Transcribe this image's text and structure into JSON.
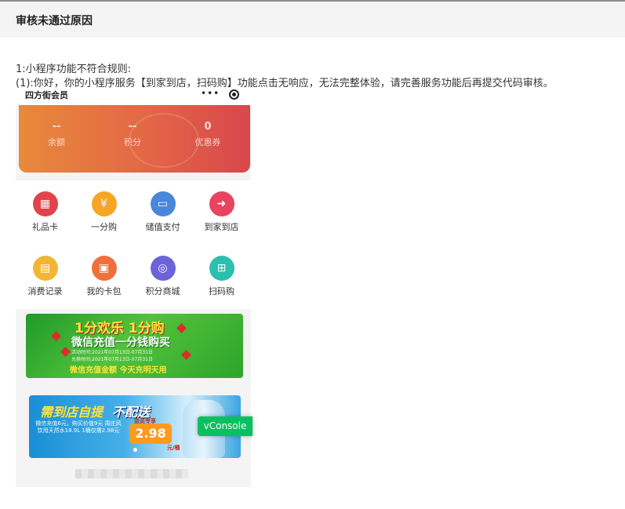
{
  "header": {
    "title": "审核未通过原因"
  },
  "reason": {
    "line1": "1:小程序功能不符合规则:",
    "line2": "(1):你好，你的小程序服务【到家到店，扫码购】功能点击无响应，无法完整体验，请完善服务功能后再提交代码审核。"
  },
  "phone": {
    "shop_name": "四方街会员",
    "menu_dots": "•••",
    "stats": [
      {
        "value": "--",
        "label": "余额"
      },
      {
        "value": "--",
        "label": "积分"
      },
      {
        "value": "0",
        "label": "优惠券"
      }
    ],
    "grid": [
      {
        "label": "礼品卡",
        "icon": "gift-icon",
        "color": "#e0434a",
        "glyph": "🎁"
      },
      {
        "label": "一分购",
        "icon": "coupon-icon",
        "color": "#f5a623",
        "glyph": "¥"
      },
      {
        "label": "储值支付",
        "icon": "card-icon",
        "color": "#4a86d9",
        "glyph": "▭"
      },
      {
        "label": "到家到店",
        "icon": "delivery-icon",
        "color": "#e8435f",
        "glyph": "🛵"
      },
      {
        "label": "消费记录",
        "icon": "record-icon",
        "color": "#f2b634",
        "glyph": "▤"
      },
      {
        "label": "我的卡包",
        "icon": "wallet-icon",
        "color": "#f0703a",
        "glyph": "▣"
      },
      {
        "label": "积分商城",
        "icon": "points-icon",
        "color": "#6c63d9",
        "glyph": "◎"
      },
      {
        "label": "扫码购",
        "icon": "cart-icon",
        "color": "#2bbfb0",
        "glyph": "🛒"
      }
    ],
    "promo1": {
      "title": "1分欢乐 1分购",
      "subtitle": "微信充值一分钱购买",
      "date_line1": "活动时间:2021年07月13日-07月31日",
      "date_line2": "兑换时间:2021年07月13日-07月31日",
      "slogan": "微信充值金额  今天充明天用"
    },
    "promo2": {
      "title_a": "需到店自提",
      "title_b": "不配送",
      "desc": "微信充值6元，购买价值9元 周庄风饮用天然水18.9L 1桶仅需2.98元",
      "tag": "会员专享",
      "price": "2.98",
      "unit": "元/桶"
    },
    "vconsole": "vConsole"
  }
}
